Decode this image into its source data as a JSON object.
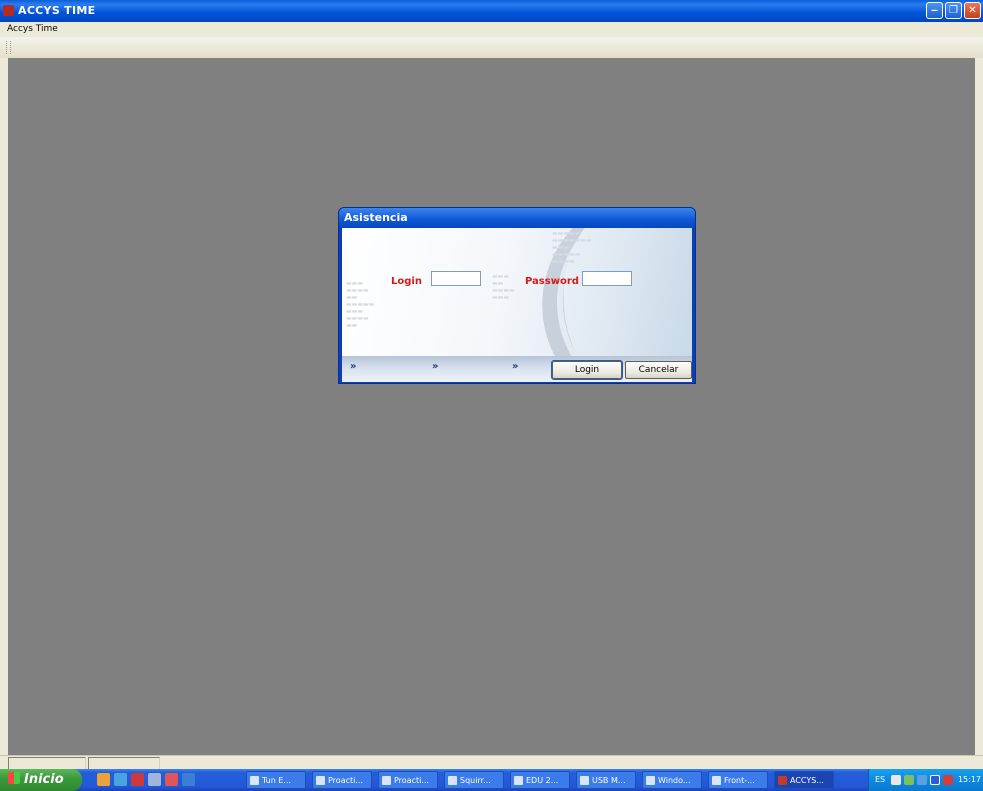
{
  "window": {
    "title": "ACCYS TIME",
    "menu_label": "Accys Time",
    "buttons": {
      "minimize": "minimize-icon",
      "restore": "restore-icon",
      "close": "close-icon"
    }
  },
  "dialog": {
    "title": "Asistencia",
    "login_label": "Login",
    "login_value": "",
    "password_label": "Password",
    "password_value": "",
    "chevron": "»",
    "login_button": "Login",
    "cancel_button": "Cancelar",
    "label_color": "#d61a1a"
  },
  "taskbar": {
    "start_label": "Inicio",
    "tasks": [
      {
        "label": "Tun E..."
      },
      {
        "label": "Proacti..."
      },
      {
        "label": "Proacti..."
      },
      {
        "label": "Squirr..."
      },
      {
        "label": "EDU 2..."
      },
      {
        "label": "USB M..."
      },
      {
        "label": "Windo..."
      },
      {
        "label": "Front-..."
      },
      {
        "label": "ACCYS..."
      }
    ],
    "tray": {
      "language": "ES",
      "clock": "15:17"
    }
  }
}
